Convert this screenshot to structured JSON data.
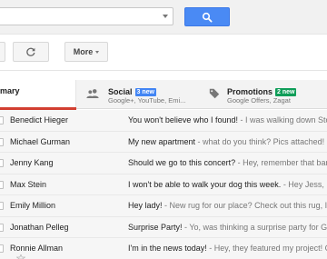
{
  "search": {
    "placeholder": "",
    "button_icon": "search-icon"
  },
  "toolbar": {
    "more_label": "More",
    "refresh_icon": "refresh-icon"
  },
  "tabs": [
    {
      "id": "primary",
      "label": "mary",
      "selected": true
    },
    {
      "id": "social",
      "label": "Social",
      "badge": "3 new",
      "badge_color": "#4285f4",
      "subtitle": "Google+, YouTube, Emi...",
      "icon": "people-icon"
    },
    {
      "id": "promotions",
      "label": "Promotions",
      "badge": "2 new",
      "badge_color": "#0f9d58",
      "subtitle": "Google Offers, Zagat",
      "icon": "tag-icon"
    }
  ],
  "emails": [
    {
      "sender": "Benedict Hieger",
      "subject": "You won't believe who I found!",
      "preview": " - I was walking down Stock"
    },
    {
      "sender": "Michael Gurman",
      "subject": "My new apartment",
      "preview": " - what do you think? Pics attached!"
    },
    {
      "sender": "Jenny Kang",
      "subject": "Should we go to this concert?",
      "preview": " - Hey, remember that band"
    },
    {
      "sender": "Max Stein",
      "subject": "I won't be able to walk your dog this week.",
      "preview": " - Hey Jess, I'm"
    },
    {
      "sender": "Emily Million",
      "subject": "Hey lady!",
      "preview": " - New rug for our place? Check out this rug, I th"
    },
    {
      "sender": "Jonathan Pelleg",
      "subject": "Surprise Party!",
      "preview": " - Yo, was thinking a surprise party for Gu"
    },
    {
      "sender": "Ronnie Allman",
      "subject": "I'm in the news today!",
      "preview": " - Hey, they featured my project! Che"
    }
  ],
  "colors": {
    "accent": "#4a8af4",
    "selected_tab_underline": "#d23f31"
  }
}
